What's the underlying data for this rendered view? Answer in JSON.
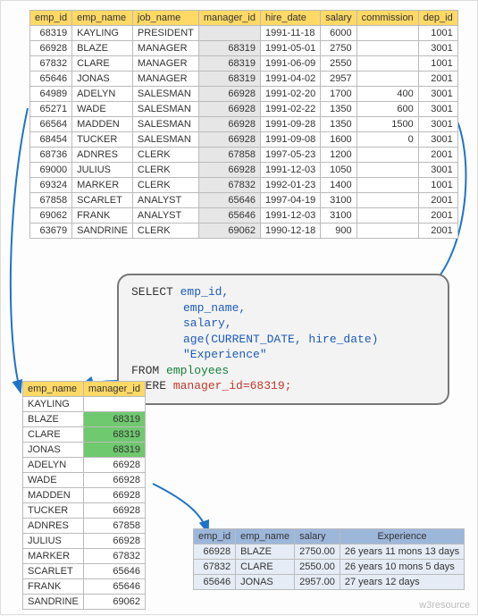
{
  "table1": {
    "headers": [
      "emp_id",
      "emp_name",
      "job_name",
      "manager_id",
      "hire_date",
      "salary",
      "commission",
      "dep_id"
    ],
    "rows": [
      [
        "68319",
        "KAYLING",
        "PRESIDENT",
        "",
        "1991-11-18",
        "6000",
        "",
        "1001"
      ],
      [
        "66928",
        "BLAZE",
        "MANAGER",
        "68319",
        "1991-05-01",
        "2750",
        "",
        "3001"
      ],
      [
        "67832",
        "CLARE",
        "MANAGER",
        "68319",
        "1991-06-09",
        "2550",
        "",
        "1001"
      ],
      [
        "65646",
        "JONAS",
        "MANAGER",
        "68319",
        "1991-04-02",
        "2957",
        "",
        "2001"
      ],
      [
        "64989",
        "ADELYN",
        "SALESMAN",
        "66928",
        "1991-02-20",
        "1700",
        "400",
        "3001"
      ],
      [
        "65271",
        "WADE",
        "SALESMAN",
        "66928",
        "1991-02-22",
        "1350",
        "600",
        "3001"
      ],
      [
        "66564",
        "MADDEN",
        "SALESMAN",
        "66928",
        "1991-09-28",
        "1350",
        "1500",
        "3001"
      ],
      [
        "68454",
        "TUCKER",
        "SALESMAN",
        "66928",
        "1991-09-08",
        "1600",
        "0",
        "3001"
      ],
      [
        "68736",
        "ADNRES",
        "CLERK",
        "67858",
        "1997-05-23",
        "1200",
        "",
        "2001"
      ],
      [
        "69000",
        "JULIUS",
        "CLERK",
        "66928",
        "1991-12-03",
        "1050",
        "",
        "3001"
      ],
      [
        "69324",
        "MARKER",
        "CLERK",
        "67832",
        "1992-01-23",
        "1400",
        "",
        "1001"
      ],
      [
        "67858",
        "SCARLET",
        "ANALYST",
        "65646",
        "1997-04-19",
        "3100",
        "",
        "2001"
      ],
      [
        "69062",
        "FRANK",
        "ANALYST",
        "65646",
        "1991-12-03",
        "3100",
        "",
        "2001"
      ],
      [
        "63679",
        "SANDRINE",
        "CLERK",
        "69062",
        "1990-12-18",
        "900",
        "",
        "2001"
      ]
    ]
  },
  "sql": {
    "line1a": "SELECT ",
    "line1b": "emp_id,",
    "line2": "emp_name,",
    "line3": "salary,",
    "line4": "age(CURRENT_DATE, hire_date) \"Experience\"",
    "line5a": "FROM ",
    "line5b": "employees",
    "line6a": "WHERE ",
    "line6b": "manager_id=68319;"
  },
  "table2": {
    "headers": [
      "emp_name",
      "manager_id"
    ],
    "rows": [
      [
        "KAYLING",
        "",
        false
      ],
      [
        "BLAZE",
        "68319",
        true
      ],
      [
        "CLARE",
        "68319",
        true
      ],
      [
        "JONAS",
        "68319",
        true
      ],
      [
        "ADELYN",
        "66928",
        false
      ],
      [
        "WADE",
        "66928",
        false
      ],
      [
        "MADDEN",
        "66928",
        false
      ],
      [
        "TUCKER",
        "66928",
        false
      ],
      [
        "ADNRES",
        "67858",
        false
      ],
      [
        "JULIUS",
        "66928",
        false
      ],
      [
        "MARKER",
        "67832",
        false
      ],
      [
        "SCARLET",
        "65646",
        false
      ],
      [
        "FRANK",
        "65646",
        false
      ],
      [
        "SANDRINE",
        "69062",
        false
      ]
    ]
  },
  "table3": {
    "headers": [
      "emp_id",
      "emp_name",
      "salary",
      "Experience"
    ],
    "rows": [
      [
        "66928",
        "BLAZE",
        "2750.00",
        "26 years 11 mons 13 days"
      ],
      [
        "67832",
        "CLARE",
        "2550.00",
        "26 years 10 mons 5 days"
      ],
      [
        "65646",
        "JONAS",
        "2957.00",
        "27 years 12 days"
      ]
    ]
  },
  "watermark": "w3resource"
}
